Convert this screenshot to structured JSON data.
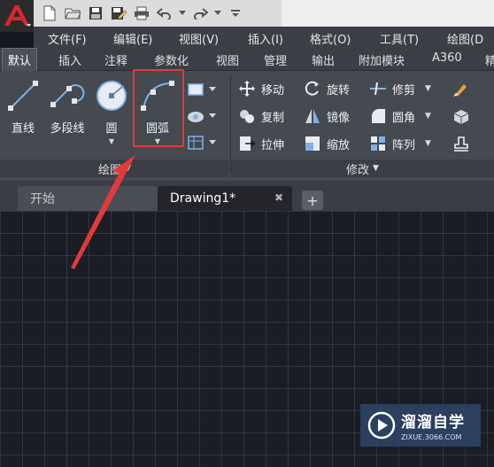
{
  "app": {
    "logo_letter": "A"
  },
  "quick_access": {
    "icons": [
      "new-file-icon",
      "open-folder-icon",
      "save-icon",
      "save-as-icon",
      "print-icon",
      "undo-icon",
      "redo-icon",
      "customize-icon"
    ]
  },
  "menu": {
    "items": [
      {
        "label": "文件(F)"
      },
      {
        "label": "编辑(E)"
      },
      {
        "label": "视图(V)"
      },
      {
        "label": "插入(I)"
      },
      {
        "label": "格式(O)"
      },
      {
        "label": "工具(T)"
      },
      {
        "label": "绘图(D"
      }
    ]
  },
  "ribbon_tabs": {
    "items": [
      {
        "label": "默认",
        "active": true
      },
      {
        "label": "插入"
      },
      {
        "label": "注释"
      },
      {
        "label": "参数化"
      },
      {
        "label": "视图"
      },
      {
        "label": "管理"
      },
      {
        "label": "输出"
      },
      {
        "label": "附加模块"
      },
      {
        "label": "A360"
      },
      {
        "label": "精"
      }
    ]
  },
  "draw_panel": {
    "title": "绘图",
    "buttons": [
      {
        "label": "直线",
        "icon": "line-icon"
      },
      {
        "label": "多段线",
        "icon": "polyline-icon"
      },
      {
        "label": "圆",
        "icon": "circle-icon"
      },
      {
        "label": "圆弧",
        "icon": "arc-icon",
        "highlighted": true
      }
    ]
  },
  "modify_panel": {
    "title": "修改",
    "items": [
      {
        "label": "移动",
        "icon": "move-icon"
      },
      {
        "label": "旋转",
        "icon": "rotate-icon"
      },
      {
        "label": "修剪",
        "icon": "trim-icon"
      },
      {
        "label": "复制",
        "icon": "copy-icon"
      },
      {
        "label": "镜像",
        "icon": "mirror-icon"
      },
      {
        "label": "圆角",
        "icon": "fillet-icon"
      },
      {
        "label": "拉伸",
        "icon": "stretch-icon"
      },
      {
        "label": "缩放",
        "icon": "scale-icon"
      },
      {
        "label": "阵列",
        "icon": "array-icon"
      }
    ]
  },
  "doc_tabs": {
    "items": [
      {
        "label": "开始"
      },
      {
        "label": "Drawing1*",
        "active": true
      }
    ],
    "add_label": "+"
  },
  "watermark": {
    "main": "溜溜自学",
    "sub": "ZIXUE.3066.COM"
  },
  "colors": {
    "accent_highlight": "#e23a3a",
    "annotation_arrow": "#e23a3a",
    "canvas_bg": "#1b1d24"
  }
}
